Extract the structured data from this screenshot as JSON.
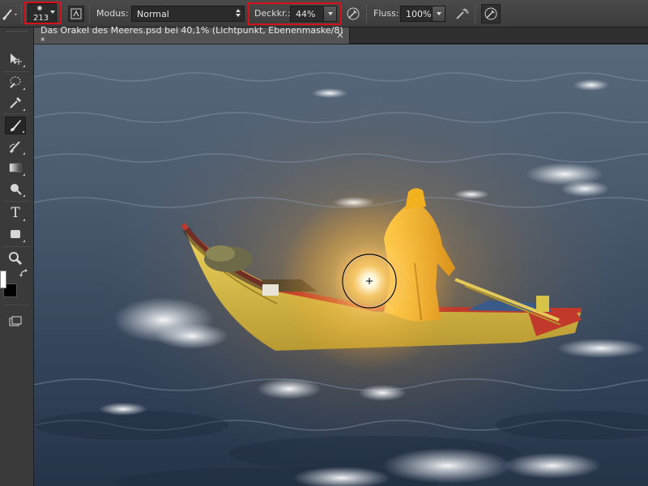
{
  "options_bar": {
    "brush_size": "213",
    "mode_label": "Modus:",
    "mode_value": "Normal",
    "opacity_label": "Deckkr.:",
    "opacity_value": "44%",
    "flow_label": "Fluss:",
    "flow_value": "100%"
  },
  "document_tab": {
    "title": "Das Orakel des Meeres.psd bei 40,1% (Lichtpunkt, Ebenenmaske/8) *",
    "close": "×"
  },
  "toolbox": {
    "tools": [
      {
        "name": "move-tool-icon"
      },
      {
        "name": "quick-selection-tool-icon"
      },
      {
        "name": "eyedropper-tool-icon"
      },
      {
        "name": "brush-tool-icon",
        "active": true
      },
      {
        "name": "history-brush-tool-icon"
      },
      {
        "name": "gradient-tool-icon"
      },
      {
        "name": "dodge-tool-icon"
      },
      {
        "name": "type-tool-icon"
      },
      {
        "name": "shape-tool-icon"
      },
      {
        "name": "zoom-tool-icon"
      }
    ],
    "type_tool_glyph": "T",
    "foreground_color": "#ffffff",
    "background_color": "#000000"
  },
  "colors": {
    "highlight_box": "#d8101a",
    "sea": "#3e4d60",
    "boat_hull": "#e3c44a",
    "boat_rim": "#c0392b",
    "raincoat": "#f2b11e",
    "glow": "#ffb640"
  }
}
